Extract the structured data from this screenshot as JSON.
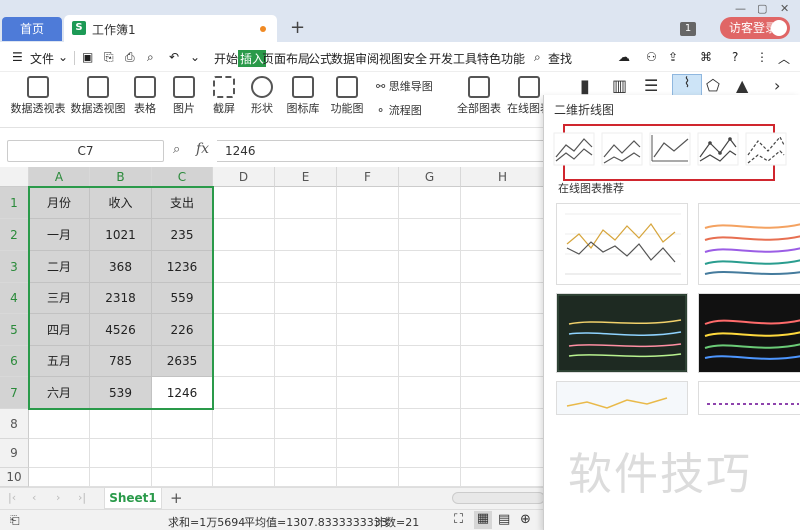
{
  "tabs": {
    "home": "首页",
    "workbook": "工作簿1",
    "badge": "1",
    "login": "访客登录"
  },
  "menu": {
    "file": "文件",
    "items": [
      "开始",
      "插入",
      "页面布局",
      "公式",
      "数据",
      "审阅",
      "视图",
      "安全",
      "开发工具",
      "特色功能"
    ],
    "active": "插入",
    "search": "查找"
  },
  "ribbon": {
    "items": [
      "数据透视表",
      "数据透视图",
      "表格",
      "图片",
      "截屏",
      "形状",
      "图标库",
      "功能图",
      "全部图表",
      "在线图表"
    ],
    "mindmap": "思维导图",
    "flowchart": "流程图"
  },
  "formula": {
    "cell_ref": "C7",
    "fx": "fx",
    "value": "1246"
  },
  "grid": {
    "columns": [
      "A",
      "B",
      "C",
      "D",
      "E",
      "F",
      "G",
      "H"
    ],
    "rows": [
      "1",
      "2",
      "3",
      "4",
      "5",
      "6",
      "7",
      "8",
      "9",
      "10"
    ],
    "data": [
      [
        "月份",
        "收入",
        "支出"
      ],
      [
        "一月",
        "1021",
        "235"
      ],
      [
        "二月",
        "368",
        "1236"
      ],
      [
        "三月",
        "2318",
        "559"
      ],
      [
        "四月",
        "4526",
        "226"
      ],
      [
        "五月",
        "785",
        "2635"
      ],
      [
        "六月",
        "539",
        "1246"
      ]
    ]
  },
  "sheet": {
    "name": "Sheet1"
  },
  "status": {
    "sum": "求和=1万5694",
    "avg": "平均值=1307.8333333333",
    "count": "计数=21"
  },
  "panel": {
    "title": "二维折线图",
    "section": "在线图表推荐"
  },
  "watermark": "软件技巧",
  "colors": {
    "accent": "#2a9a4a",
    "tab_blue": "#4e7bd8",
    "login_red": "#e06666",
    "highlight_box": "#d0262e"
  }
}
